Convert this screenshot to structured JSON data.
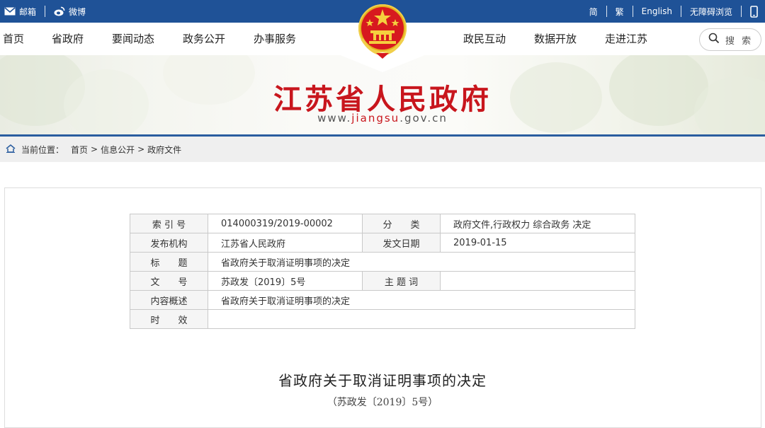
{
  "topbar": {
    "mail_label": "邮箱",
    "weibo_label": "微博",
    "simplified_label": "简",
    "traditional_label": "繁",
    "english_label": "English",
    "accessibility_label": "无障碍浏览"
  },
  "nav": {
    "items": [
      "首页",
      "省政府",
      "要闻动态",
      "政务公开",
      "办事服务",
      "政民互动",
      "数据开放",
      "走进江苏"
    ],
    "search_label": "搜 索"
  },
  "banner": {
    "title": "江苏省人民政府",
    "url_prefix": "www.",
    "url_highlight": "jiangsu",
    "url_suffix": ".gov.cn"
  },
  "breadcrumb": {
    "label": "当前位置：",
    "items": [
      "首页",
      "信息公开",
      "政府文件"
    ],
    "separator": ">"
  },
  "meta": {
    "index_key": "索 引 号",
    "index_value": "014000319/2019-00002",
    "category_key": "分　　类",
    "category_value": "政府文件,行政权力 综合政务 决定",
    "issuer_key": "发布机构",
    "issuer_value": "江苏省人民政府",
    "date_key": "发文日期",
    "date_value": "2019-01-15",
    "title_key": "标　　题",
    "title_value": "省政府关于取消证明事项的决定",
    "docno_key": "文　　号",
    "docno_value": "苏政发〔2019〕5号",
    "keywords_key": "主 题 词",
    "keywords_value": "",
    "summary_key": "内容概述",
    "summary_value": "省政府关于取消证明事项的决定",
    "validity_key": "时　　效",
    "validity_value": ""
  },
  "document": {
    "title": "省政府关于取消证明事项的决定",
    "number": "（苏政发〔2019〕5号）"
  },
  "colors": {
    "topbar_bg": "#1f5297",
    "brand_red": "#c8161d",
    "breadcrumb_bg": "#efefef"
  }
}
